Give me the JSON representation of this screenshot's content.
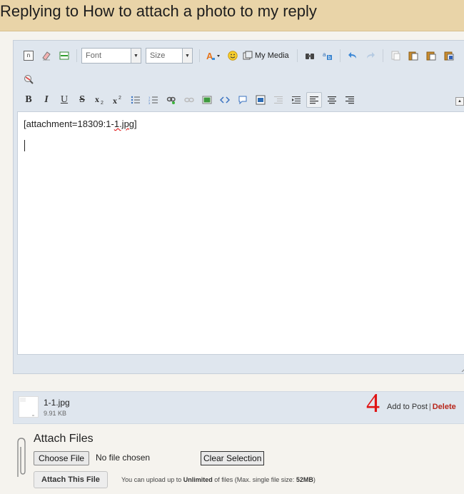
{
  "page": {
    "title": "Replying to How to attach a photo to my reply"
  },
  "toolbar": {
    "font_select": "Font",
    "size_select": "Size",
    "my_media_label": "My Media"
  },
  "editor": {
    "content_prefix": "[attachment=18309:1-",
    "content_spell": "1.jpg",
    "content_suffix": "]"
  },
  "attachment": {
    "file_name": "1-1.jpg",
    "file_size": "9.91 KB",
    "step_number": "4",
    "add_to_post": "Add to Post",
    "separator": "|",
    "delete": "Delete"
  },
  "attach_files": {
    "title": "Attach Files",
    "choose_file": "Choose File",
    "no_file": "No file chosen",
    "clear_selection": "Clear Selection",
    "attach_this_file": "Attach This File",
    "note_prefix": "You can upload up to ",
    "note_unlimited": "Unlimited",
    "note_middle": " of files (Max. single file size: ",
    "note_size": "52MB",
    "note_suffix": ")"
  },
  "colors": {
    "title_bar": "#e9d4a8",
    "editor_chrome": "#dfe6ee",
    "step_number": "#e01414",
    "delete_link": "#b8261b"
  }
}
